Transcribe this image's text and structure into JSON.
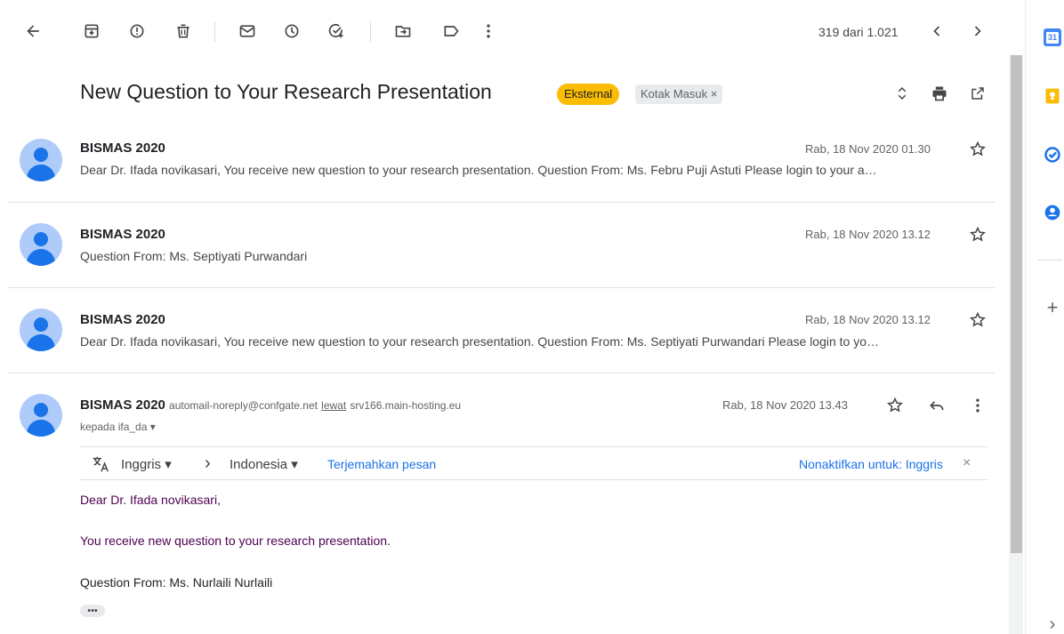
{
  "toolbar": {
    "back_icon": "arrow-back-icon",
    "archive_icon": "archive-icon",
    "spam_icon": "report-spam-icon",
    "delete_icon": "delete-icon",
    "unread_icon": "mark-unread-icon",
    "snooze_icon": "snooze-icon",
    "task_icon": "add-task-icon",
    "move_icon": "move-to-icon",
    "label_icon": "label-icon",
    "more_icon": "more-vert-icon",
    "pager_text": "319 dari 1.021"
  },
  "subject": {
    "title": "New Question to Your Research Presentation",
    "badge_external": "Eksternal",
    "badge_inbox": "Kotak Masuk ×"
  },
  "messages": [
    {
      "sender": "BISMAS 2020",
      "date": "Rab, 18 Nov 2020 01.30",
      "snippet": "Dear Dr. Ifada novikasari, You receive new question to your research presentation. Question From: Ms. Febru Puji Astuti Please login to your a…"
    },
    {
      "sender": "BISMAS 2020",
      "date": "Rab, 18 Nov 2020 13.12",
      "snippet": "Question From: Ms. Septiyati Purwandari"
    },
    {
      "sender": "BISMAS 2020",
      "date": "Rab, 18 Nov 2020 13.12",
      "snippet": "Dear Dr. Ifada novikasari, You receive new question to your research presentation. Question From: Ms. Septiyati Purwandari Please login to yo…"
    },
    {
      "sender": "BISMAS 2020",
      "email": "automail-noreply@confgate.net",
      "via_label": "lewat",
      "via_host": "srv166.main-hosting.eu",
      "date": "Rab, 18 Nov 2020 13.43",
      "to": "kepada ifa_da ▾"
    }
  ],
  "translate": {
    "from_lang": "Inggris ▾",
    "arrow": "›",
    "to_lang": "Indonesia ▾",
    "translate_link": "Terjemahkan pesan",
    "disable_link": "Nonaktifkan untuk: Inggris",
    "close": "×"
  },
  "body": {
    "greeting": "Dear Dr. Ifada novikasari,",
    "line1": "You receive new question to your research presentation.",
    "line2": "Question From: Ms. Nurlaili Nurlaili",
    "more": "•••"
  },
  "side_panel": {
    "calendar_label": "31",
    "add": "+",
    "expand": "›"
  },
  "colors": {
    "external_badge": "#fbbc04",
    "link": "#1a73e8",
    "quoted_text": "#500050"
  }
}
